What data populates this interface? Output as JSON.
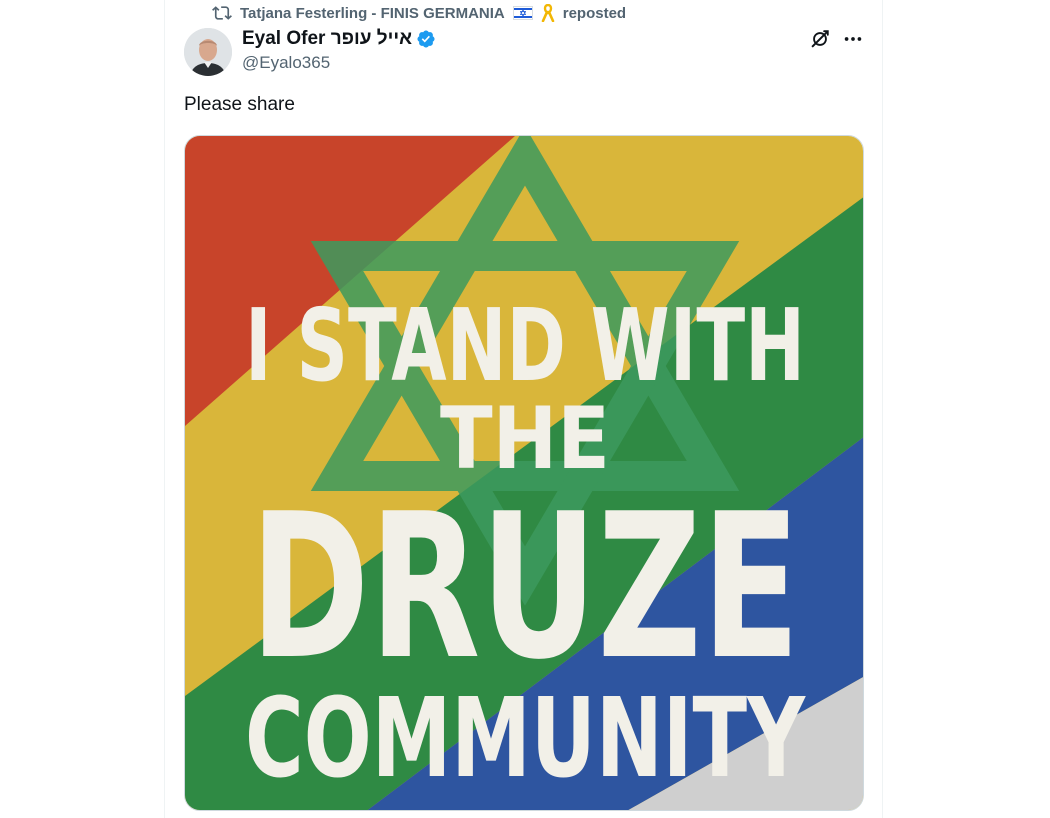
{
  "repost": {
    "reposter_name": "Tatjana Festerling - FINIS GERMANIA",
    "label": "reposted"
  },
  "author": {
    "display_name": "Eyal Ofer אייל עופר",
    "handle": "@Eyalo365",
    "verified": true
  },
  "tweet": {
    "text": "Please share"
  },
  "media_image": {
    "line1": "I STAND WITH",
    "line2": "THE",
    "line3": "DRUZE",
    "line4": "COMMUNITY",
    "stripe_colors": [
      "#c8442a",
      "#d9b63a",
      "#2f8a44",
      "#2e55a0",
      "#cfcfcf"
    ],
    "star_color": "#3d9a5e"
  },
  "colors": {
    "secondary_text": "#536471",
    "verified_blue": "#1d9bf0"
  },
  "icons": {
    "repost": "repost-icon",
    "verified": "verified-badge-icon",
    "grok": "grok-icon",
    "more": "more-dots-icon"
  }
}
